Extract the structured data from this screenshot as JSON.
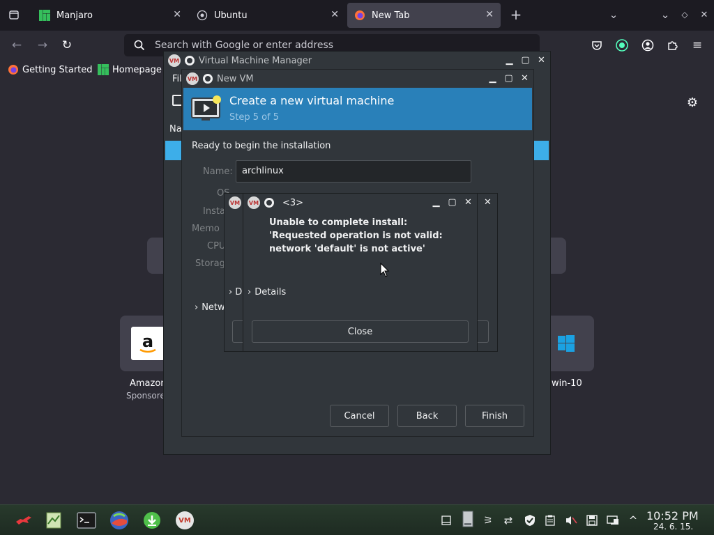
{
  "firefox": {
    "tabs": [
      {
        "label": "Manjaro"
      },
      {
        "label": "Ubuntu"
      },
      {
        "label": "New Tab"
      }
    ],
    "url_placeholder": "Search with Google or enter address",
    "bookmarks": [
      {
        "label": "Getting Started"
      },
      {
        "label": "Homepage"
      }
    ],
    "tiles": [
      {
        "label": "Amazon",
        "sub": "Sponsored"
      },
      {
        "label": "win-10",
        "sub": ""
      }
    ]
  },
  "vmm": {
    "title": "Virtual Machine Manager",
    "menu_partial": "Fil",
    "list_header_partial": "Na"
  },
  "newvm": {
    "title": "New VM",
    "header_title": "Create a new virtual machine",
    "header_step": "Step 5 of 5",
    "ready_text": "Ready to begin the installation",
    "name_label": "Name:",
    "name_value": "archlinux",
    "os_label_partial": "OS",
    "install_label_partial": "Insta",
    "memory_label_partial": "Memo",
    "cpu_label_partial": "CPU",
    "storage_label_partial": "Storag",
    "network_partial": "Netw",
    "buttons": {
      "cancel": "Cancel",
      "back": "Back",
      "finish": "Finish"
    }
  },
  "error_dialog": {
    "title": "<3>",
    "message": "Unable to complete install: 'Requested operation is not valid: network 'default' is not active'",
    "details_label": "Details",
    "behind_details_partial": "D",
    "close_label": "Close"
  },
  "taskbar": {
    "time": "10:52 PM",
    "date": "24. 6. 15."
  },
  "colors": {
    "accent": "#2980b9",
    "window_bg": "#31363b",
    "firefox_bg": "#2b2a33"
  }
}
